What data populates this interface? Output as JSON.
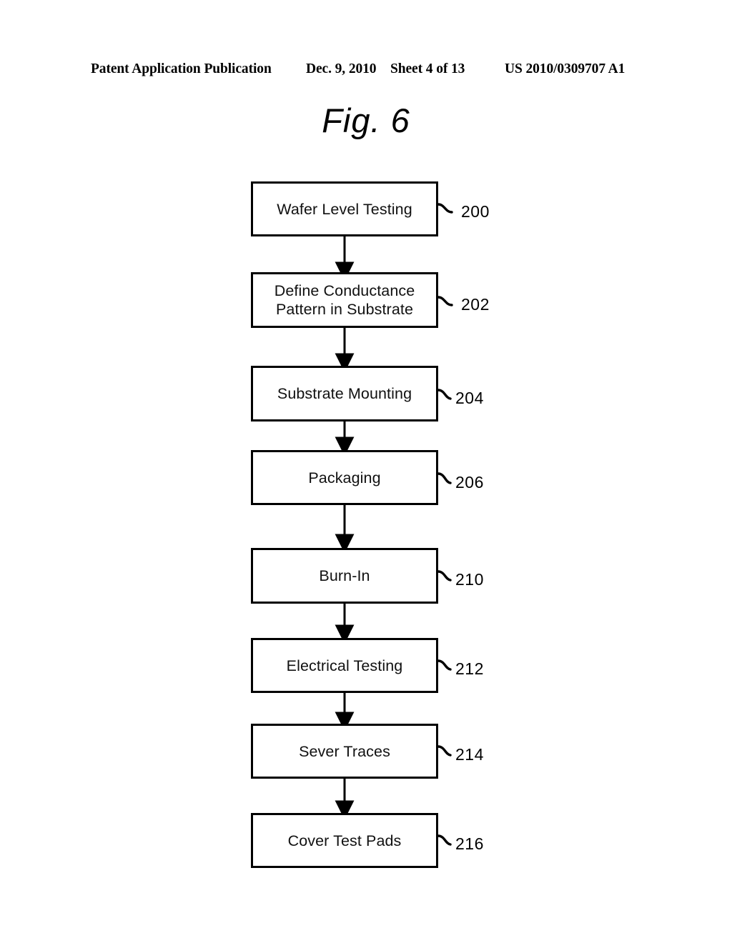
{
  "header": {
    "left": "Patent Application Publication",
    "date": "Dec. 9, 2010",
    "sheet": "Sheet 4 of 13",
    "publication_number": "US 2010/0309707 A1"
  },
  "figure": {
    "title": "Fig. 6"
  },
  "flowchart": {
    "type": "process-flow",
    "orientation": "vertical",
    "steps": [
      {
        "label": "Wafer Level Testing",
        "ref": "200",
        "lines": [
          "Wafer Level Testing"
        ]
      },
      {
        "label": "Define Conductance Pattern in Substrate",
        "ref": "202",
        "lines": [
          "Define Conductance",
          "Pattern in Substrate"
        ]
      },
      {
        "label": "Substrate Mounting",
        "ref": "204",
        "lines": [
          "Substrate Mounting"
        ]
      },
      {
        "label": "Packaging",
        "ref": "206",
        "lines": [
          "Packaging"
        ]
      },
      {
        "label": "Burn-In",
        "ref": "210",
        "lines": [
          "Burn-In"
        ]
      },
      {
        "label": "Electrical Testing",
        "ref": "212",
        "lines": [
          "Electrical Testing"
        ]
      },
      {
        "label": "Sever Traces",
        "ref": "214",
        "lines": [
          "Sever Traces"
        ]
      },
      {
        "label": "Cover Test Pads",
        "ref": "216",
        "lines": [
          "Cover Test Pads"
        ]
      }
    ],
    "colors": {
      "stroke": "#000000",
      "fill": "#ffffff",
      "text": "#111111"
    }
  }
}
